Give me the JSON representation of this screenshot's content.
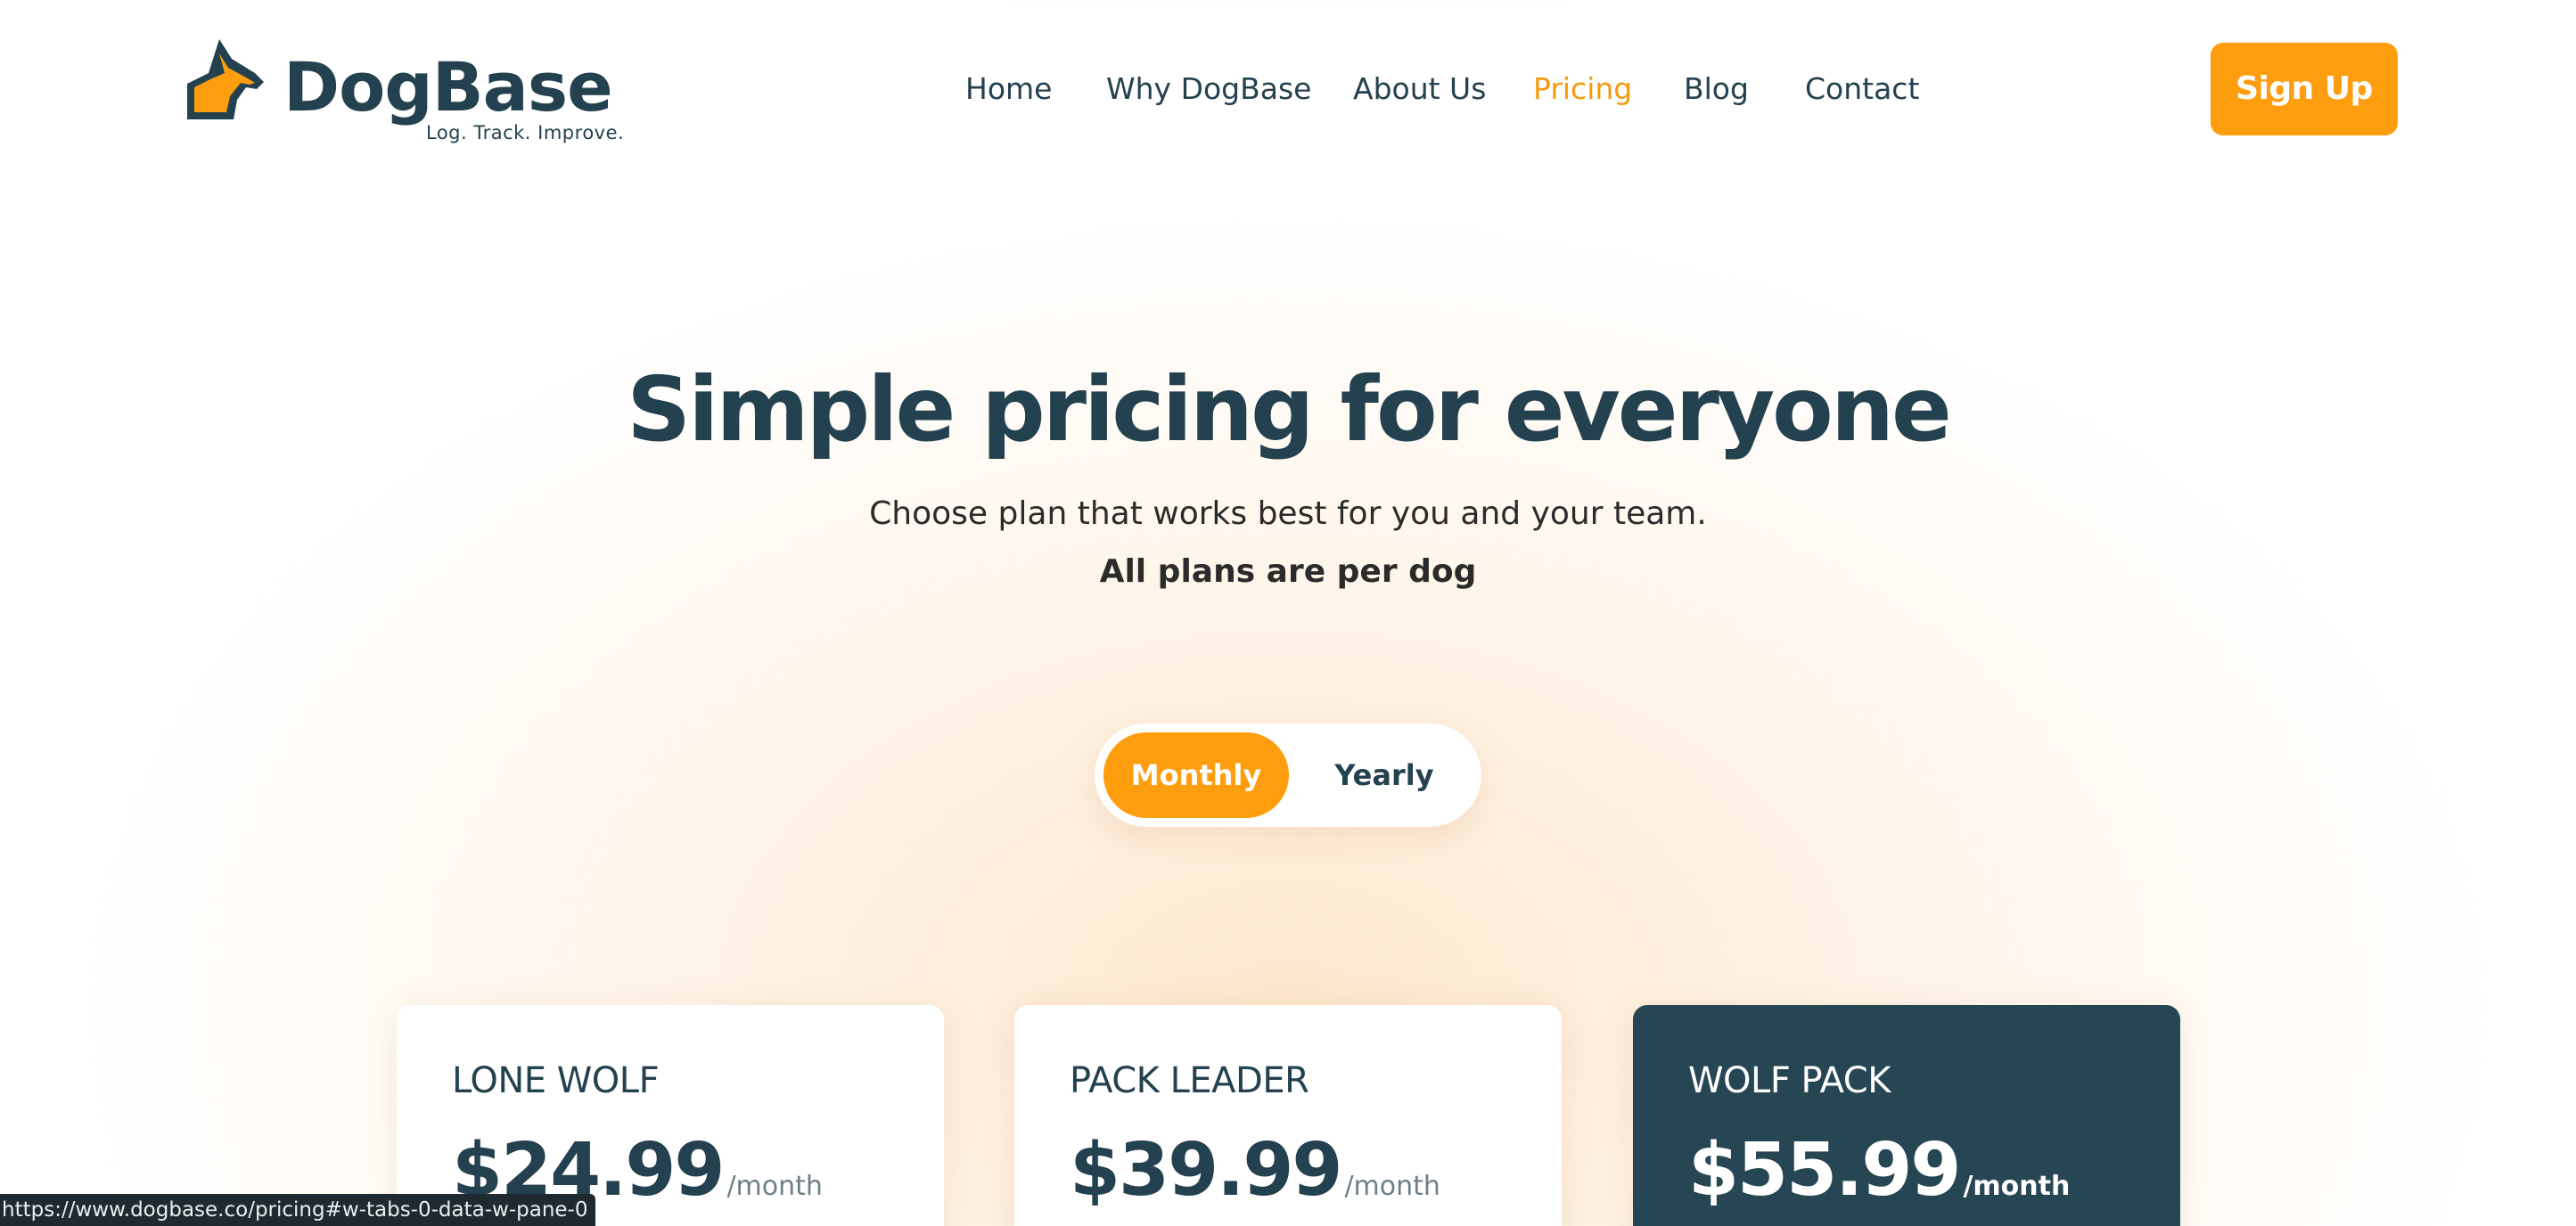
{
  "brand": {
    "name": "DogBase",
    "tagline": "Log. Track. Improve.",
    "accent_color": "#fe9d0d",
    "primary_color": "#24414f"
  },
  "nav": {
    "items": [
      {
        "label": "Home",
        "active": false
      },
      {
        "label": "Why DogBase",
        "active": false
      },
      {
        "label": "About Us",
        "active": false
      },
      {
        "label": "Pricing",
        "active": true
      },
      {
        "label": "Blog",
        "active": false
      },
      {
        "label": "Contact",
        "active": false
      }
    ],
    "cta_label": "Sign Up"
  },
  "hero": {
    "title": "Simple pricing for everyone",
    "subtitle": "Choose plan that works best for you and your team.",
    "note": "All plans are per dog"
  },
  "billing_toggle": {
    "options": [
      {
        "label": "Monthly",
        "selected": true
      },
      {
        "label": "Yearly",
        "selected": false
      }
    ]
  },
  "plans": [
    {
      "name": "LONE WOLF",
      "price": "$24.99",
      "period": "/month",
      "highlighted": false
    },
    {
      "name": "PACK LEADER",
      "price": "$39.99",
      "period": "/month",
      "highlighted": false
    },
    {
      "name": "WOLF PACK",
      "price": "$55.99",
      "period": "/month",
      "highlighted": true
    }
  ],
  "status_bar": {
    "url": "https://www.dogbase.co/pricing#w-tabs-0-data-w-pane-0"
  }
}
